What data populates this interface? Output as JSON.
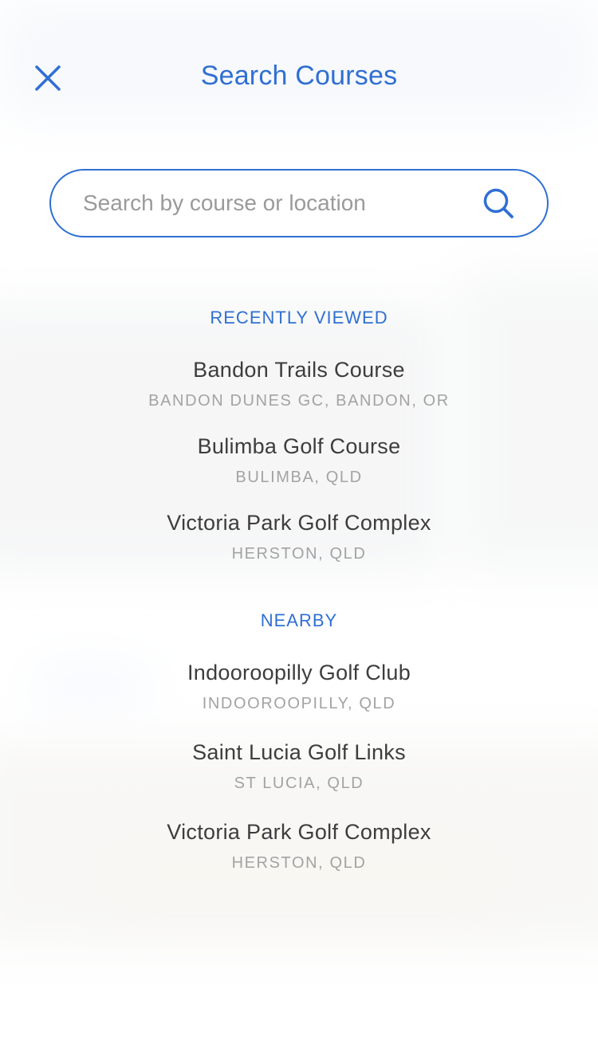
{
  "header": {
    "title": "Search Courses"
  },
  "search": {
    "placeholder": "Search by course or location"
  },
  "icons": {
    "close": "close-icon",
    "search": "search-icon"
  },
  "colors": {
    "accent": "#2f6fd3",
    "text": "#3d3d3d",
    "muted": "#a3a3a3"
  },
  "recently_viewed": {
    "heading": "RECENTLY VIEWED",
    "items": [
      {
        "name": "Bandon Trails Course",
        "location": "BANDON DUNES GC, BANDON, OR"
      },
      {
        "name": "Bulimba Golf Course",
        "location": "BULIMBA, QLD"
      },
      {
        "name": "Victoria Park Golf Complex",
        "location": "HERSTON, QLD"
      }
    ]
  },
  "nearby": {
    "heading": "NEARBY",
    "items": [
      {
        "name": "Indooroopilly Golf Club",
        "location": "INDOOROOPILLY, QLD"
      },
      {
        "name": "Saint Lucia Golf Links",
        "location": "ST LUCIA, QLD"
      },
      {
        "name": "Victoria Park Golf Complex",
        "location": "HERSTON, QLD"
      }
    ]
  }
}
